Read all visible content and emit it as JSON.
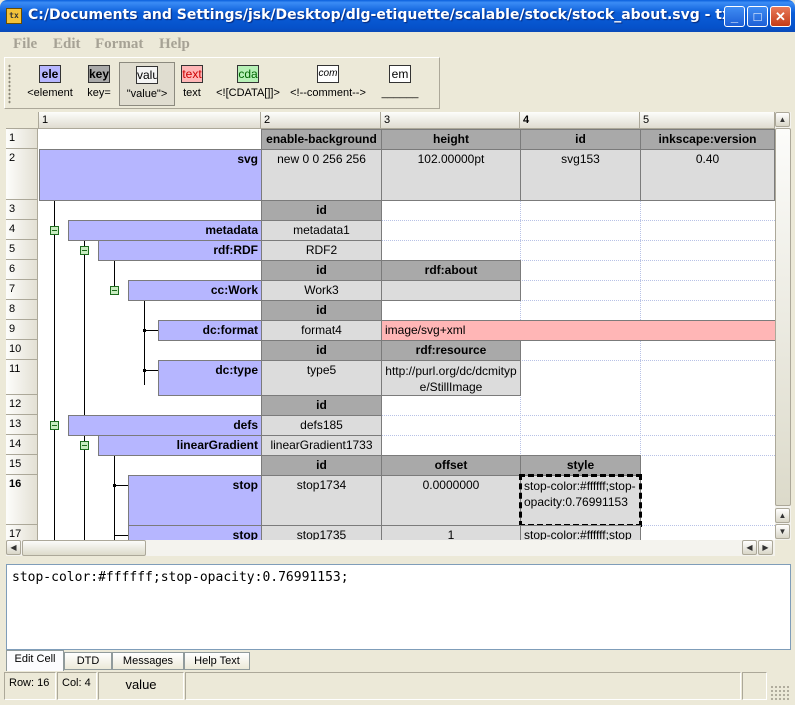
{
  "window": {
    "title": "C:/Documents and Settings/jsk/Desktop/dlg-etiquette/scalable/stock/stock_about.svg - tx",
    "app_icon_text": "tx"
  },
  "menu": [
    "File",
    "Edit",
    "Format",
    "Help"
  ],
  "toolbar": [
    {
      "icon": "ele",
      "label": "<element",
      "color": "#b6b6ff"
    },
    {
      "icon": "key",
      "label": "key=",
      "color": "#a9a9a9"
    },
    {
      "icon": "valu",
      "label": "\"value\">",
      "color": "#dcdcdc"
    },
    {
      "icon": "text",
      "label": "text",
      "color": "#ffb6b6"
    },
    {
      "icon": "cda",
      "label": "<![CDATA[]]>",
      "color": "#b6f0b6"
    },
    {
      "icon": "com",
      "label": "<!--comment-->",
      "color": "#ffffff"
    },
    {
      "icon": "em",
      "label": "______",
      "color": "#ffffff"
    }
  ],
  "grid": {
    "columns": [
      "1",
      "2",
      "3",
      "4",
      "5"
    ],
    "rows": [
      "1",
      "2",
      "3",
      "4",
      "5",
      "6",
      "7",
      "8",
      "9",
      "10",
      "11",
      "12",
      "13",
      "14",
      "15",
      "16",
      "17"
    ],
    "cells": {
      "r1": [
        "enable-background",
        "height",
        "id",
        "inkscape:version"
      ],
      "r2": {
        "elem": "svg",
        "values": [
          "new 0 0 256 256",
          "102.00000pt",
          "svg153",
          "0.40"
        ]
      },
      "r3": "id",
      "r4": {
        "elem": "metadata",
        "value": "metadata1"
      },
      "r5": {
        "elem": "rdf:RDF",
        "value": "RDF2"
      },
      "r6": [
        "id",
        "rdf:about"
      ],
      "r7": {
        "elem": "cc:Work",
        "value": "Work3"
      },
      "r8": "id",
      "r9": {
        "elem": "dc:format",
        "value": "format4",
        "text": "image/svg+xml"
      },
      "r10": [
        "id",
        "rdf:resource"
      ],
      "r11": {
        "elem": "dc:type",
        "value": "type5",
        "resource": "http://purl.org/dc/dcmitype/StillImage"
      },
      "r12": "id",
      "r13": {
        "elem": "defs",
        "value": "defs185"
      },
      "r14": {
        "elem": "linearGradient",
        "value": "linearGradient1733"
      },
      "r15": [
        "id",
        "offset",
        "style"
      ],
      "r16": {
        "elem": "stop",
        "values": [
          "stop1734",
          "0.0000000",
          "stop-color:#ffffff;stop-opacity:0.76991153"
        ]
      },
      "r17": {
        "elem": "stop",
        "values": [
          "stop1735",
          "1",
          "stop-color:#ffffff;stop"
        ]
      }
    }
  },
  "edit_cell_text": "stop-color:#ffffff;stop-opacity:0.76991153;",
  "tabs": [
    "Edit Cell",
    "DTD",
    "Messages",
    "Help Text"
  ],
  "status": {
    "row": "Row: 16",
    "col": "Col: 4",
    "type": "value"
  }
}
